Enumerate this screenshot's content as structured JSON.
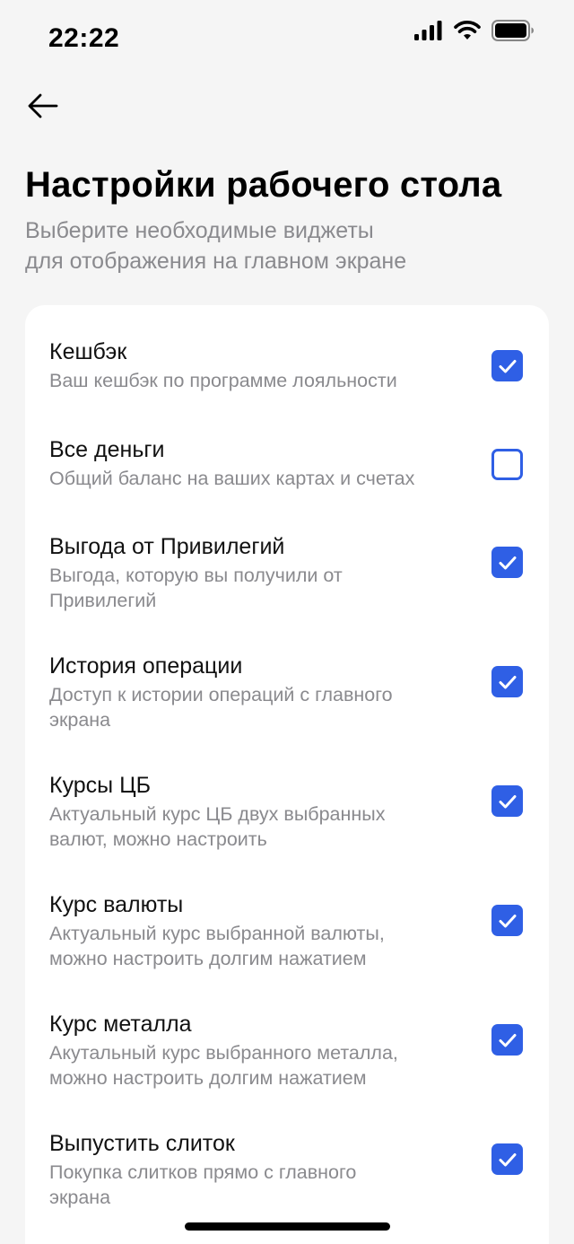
{
  "status_bar": {
    "time": "22:22",
    "icons": [
      "signal-icon",
      "wifi-icon",
      "battery-icon"
    ]
  },
  "nav": {
    "back_icon": "arrow-left-icon"
  },
  "header": {
    "title": "Настройки рабочего стола",
    "subtitle_line1": "Выберите необходимые виджеты",
    "subtitle_line2": "для отображения на главном экране"
  },
  "colors": {
    "accent": "#2f5fe5",
    "background": "#f5f5f5",
    "card": "#ffffff",
    "secondary_text": "#8a8a8e"
  },
  "widgets": [
    {
      "title": "Кешбэк",
      "desc": "Ваш кешбэк по программе лояльности",
      "checked": true
    },
    {
      "title": "Все деньги",
      "desc": "Общий баланс на ваших картах и счетах",
      "checked": false
    },
    {
      "title": "Выгода от Привилегий",
      "desc": "Выгода, которую вы получили от Привилегий",
      "checked": true
    },
    {
      "title": "История операции",
      "desc": "Доступ к истории операций с главного экрана",
      "checked": true
    },
    {
      "title": "Курсы ЦБ",
      "desc": "Актуальный курс ЦБ двух выбранных валют, можно настроить",
      "checked": true
    },
    {
      "title": "Курс валюты",
      "desc": "Актуальный курс выбранной валюты, можно настроить долгим нажатием",
      "checked": true
    },
    {
      "title": "Курс металла",
      "desc": "Акутальный курс выбранного металла, можно настроить долгим нажатием",
      "checked": true
    },
    {
      "title": "Выпустить слиток",
      "desc": "Покупка слитков прямо с главного экрана",
      "checked": true
    }
  ]
}
